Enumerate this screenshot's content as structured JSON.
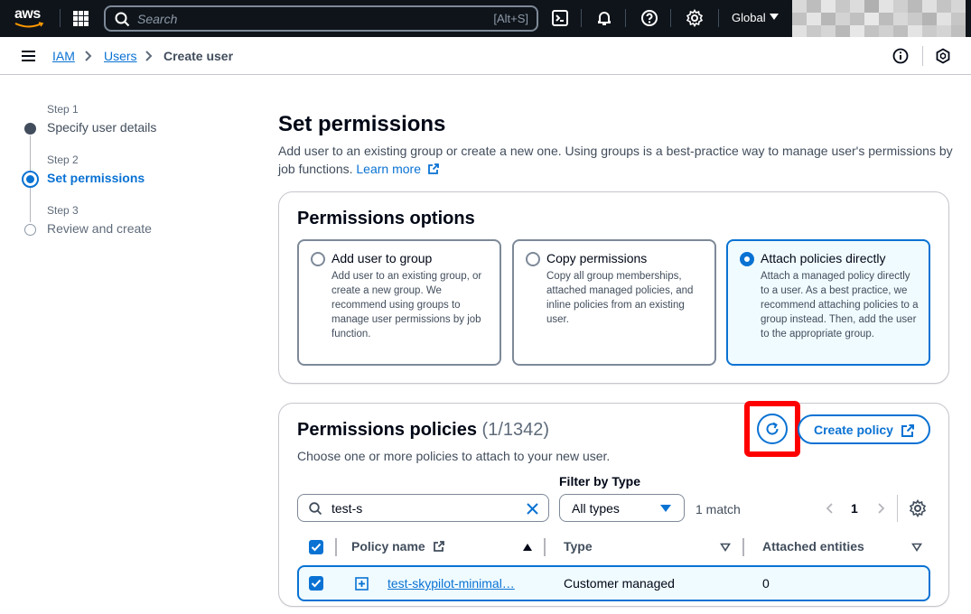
{
  "topnav": {
    "logo_text": "aws",
    "search_placeholder": "Search",
    "search_shortcut": "[Alt+S]",
    "region": "Global",
    "icons": [
      "services-grid-icon",
      "search-icon",
      "cloudshell-icon",
      "bell-icon",
      "help-icon",
      "gear-icon"
    ]
  },
  "breadcrumb": {
    "items": [
      {
        "label": "IAM"
      },
      {
        "label": "Users"
      },
      {
        "label": "Create user"
      }
    ]
  },
  "steps": [
    {
      "number": "Step 1",
      "label": "Specify user details",
      "state": "completed"
    },
    {
      "number": "Step 2",
      "label": "Set permissions",
      "state": "active"
    },
    {
      "number": "Step 3",
      "label": "Review and create",
      "state": "pending"
    }
  ],
  "page": {
    "title": "Set permissions",
    "intro": "Add user to an existing group or create a new one. Using groups is a best-practice way to manage user's permissions by job functions.",
    "learn_more": "Learn more"
  },
  "permission_options": {
    "title": "Permissions options",
    "tiles": [
      {
        "title": "Add user to group",
        "desc": "Add user to an existing group, or create a new group. We recommend using groups to manage user permissions by job function.",
        "selected": false
      },
      {
        "title": "Copy permissions",
        "desc": "Copy all group memberships, attached managed policies, and inline policies from an existing user.",
        "selected": false
      },
      {
        "title": "Attach policies directly",
        "desc": "Attach a managed policy directly to a user. As a best practice, we recommend attaching policies to a group instead. Then, add the user to the appropriate group.",
        "selected": true
      }
    ]
  },
  "policies": {
    "title": "Permissions policies",
    "count": "(1/1342)",
    "description": "Choose one or more policies to attach to your new user.",
    "create_label": "Create policy",
    "search_value": "test-s",
    "filter_label": "Filter by Type",
    "filter_value": "All types",
    "match_text": "1 match",
    "page": "1",
    "columns": {
      "name": "Policy name",
      "type": "Type",
      "attached": "Attached entities"
    },
    "rows": [
      {
        "name": "test-skypilot-minimal…",
        "type": "Customer managed",
        "attached": "0",
        "checked": true
      }
    ]
  },
  "colors": {
    "accent": "#0972d3",
    "nav_bg": "#0f141a",
    "highlight": "#ff0000"
  }
}
